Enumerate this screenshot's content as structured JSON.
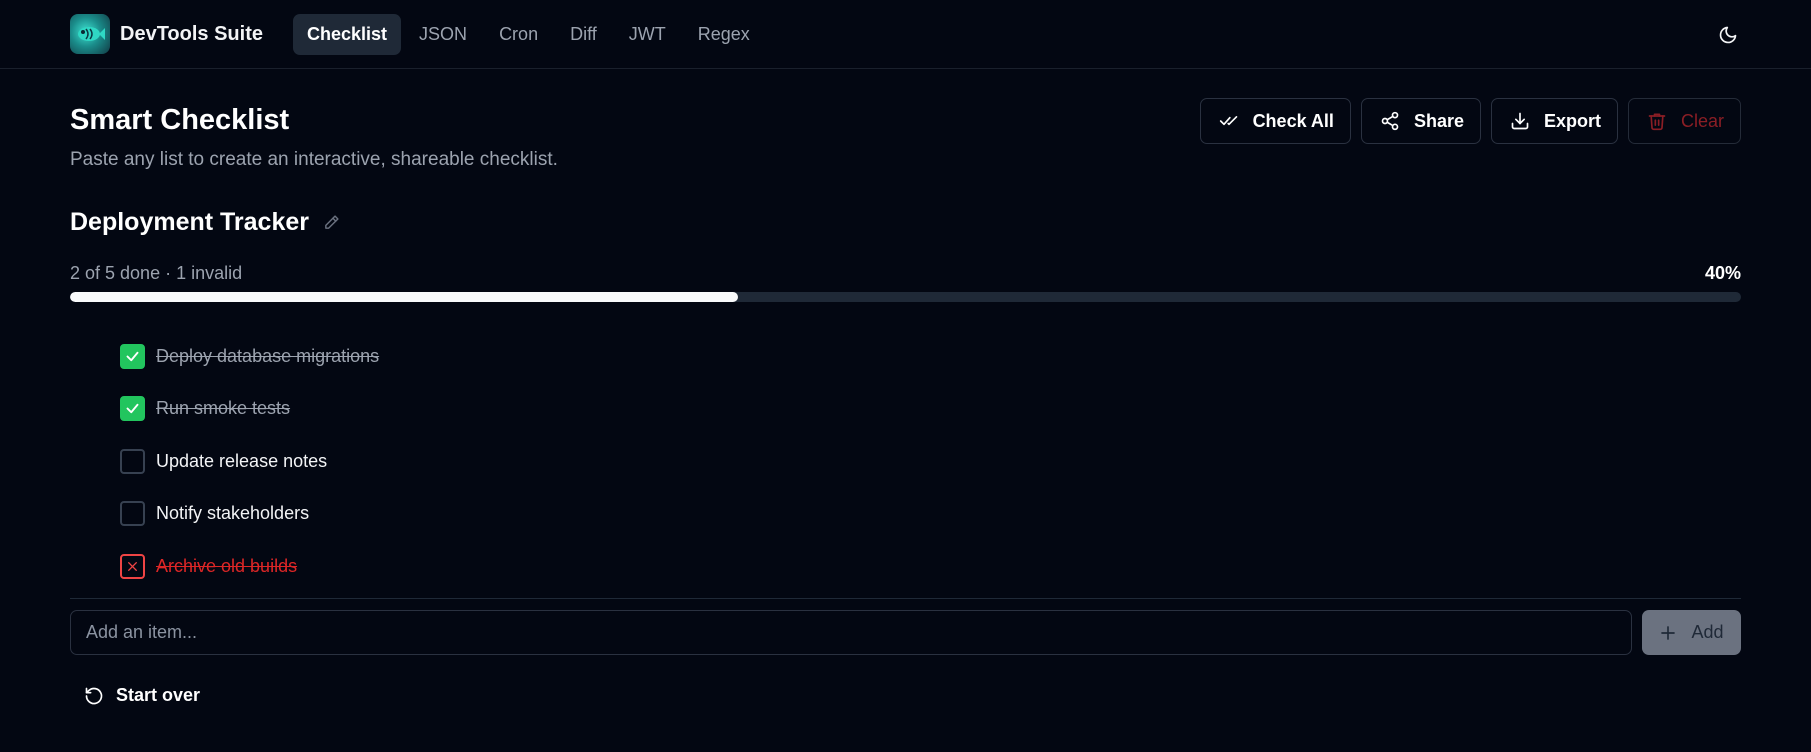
{
  "app": {
    "name": "DevTools Suite"
  },
  "nav": {
    "tabs": [
      {
        "label": "Checklist",
        "active": true
      },
      {
        "label": "JSON"
      },
      {
        "label": "Cron"
      },
      {
        "label": "Diff"
      },
      {
        "label": "JWT"
      },
      {
        "label": "Regex"
      }
    ]
  },
  "page": {
    "title": "Smart Checklist",
    "subtitle": "Paste any list to create an interactive, shareable checklist."
  },
  "actions": {
    "check_all": "Check All",
    "share": "Share",
    "export": "Export",
    "clear": "Clear"
  },
  "checklist": {
    "title": "Deployment Tracker",
    "progress_text": "2 of 5 done · 1 invalid",
    "progress_percent_label": "40%",
    "progress_fraction": 0.4,
    "items": [
      {
        "text": "Deploy database migrations",
        "state": "done"
      },
      {
        "text": "Run smoke tests",
        "state": "done"
      },
      {
        "text": "Update release notes",
        "state": "open"
      },
      {
        "text": "Notify stakeholders",
        "state": "open"
      },
      {
        "text": "Archive old builds",
        "state": "invalid"
      }
    ]
  },
  "add": {
    "placeholder": "Add an item...",
    "button_label": "Add"
  },
  "footer": {
    "start_over": "Start over"
  },
  "colors": {
    "background": "#030712",
    "checked": "#22c55e",
    "invalid": "#ef4444",
    "progress_fill": "#f9fafb"
  }
}
